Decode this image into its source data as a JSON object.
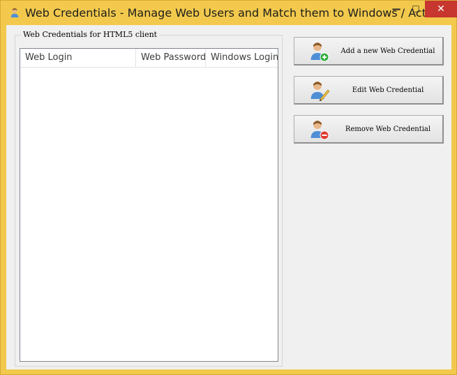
{
  "window": {
    "title": "Web Credentials - Manage Web Users and Match them to Windows / Act...",
    "controls": {
      "minimize": "−",
      "maximize": "□",
      "close": "✕"
    }
  },
  "group": {
    "label": "Web Credentials for HTML5 client"
  },
  "table": {
    "columns": [
      "Web Login",
      "Web Password",
      "Windows Login"
    ],
    "rows": []
  },
  "buttons": {
    "add": {
      "label": "Add a new Web Credential",
      "icon": "user-add-icon"
    },
    "edit": {
      "label": "Edit Web Credential",
      "icon": "user-edit-icon"
    },
    "remove": {
      "label": "Remove Web Credential",
      "icon": "user-remove-icon"
    }
  },
  "colors": {
    "frame": "#f2c94c",
    "close": "#c7372f",
    "client": "#f0f0f0"
  }
}
